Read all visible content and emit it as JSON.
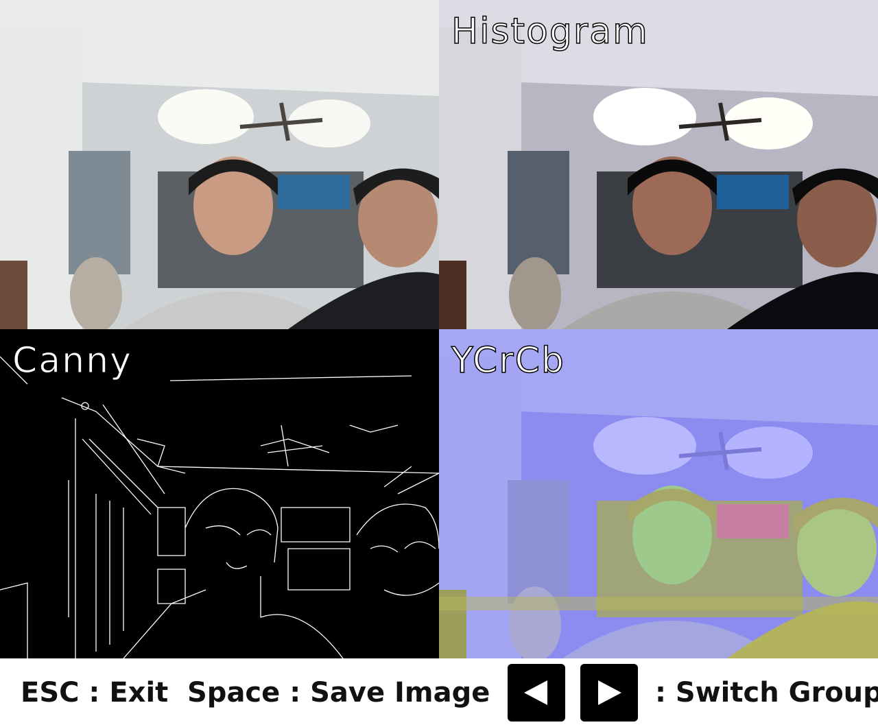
{
  "panels": {
    "original": {
      "title": ""
    },
    "histogram": {
      "title": "Histogram"
    },
    "canny": {
      "title": "Canny"
    },
    "ycrcb": {
      "title": "YCrCb"
    }
  },
  "controls": {
    "esc_label": "ESC : Exit",
    "space_label": "Space : Save Image",
    "switch_label": ": Switch Group",
    "prev_icon": "triangle-left-icon",
    "next_icon": "triangle-right-icon"
  },
  "colors": {
    "button_bg": "#000000",
    "title_fill": "#ffffff",
    "title_outline": "#000000",
    "ycrcb_tint": "#8c8cf0"
  }
}
